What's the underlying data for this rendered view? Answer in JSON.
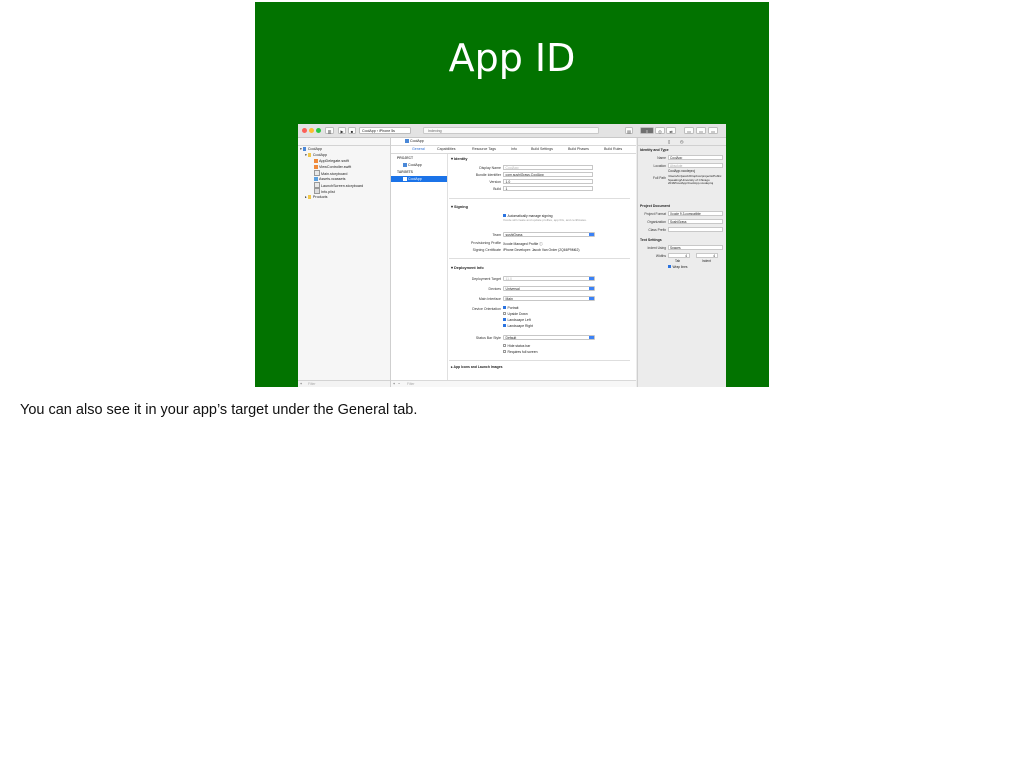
{
  "slide": {
    "title": "App ID",
    "caption": "You can also see it in your app’s target under the General tab."
  },
  "toolbar": {
    "scheme": "CoolApp",
    "device": "iPhone 5s",
    "status": "Indexing"
  },
  "navigator": {
    "items": [
      {
        "label": "CoolApp"
      },
      {
        "label": "CoolApp"
      },
      {
        "label": "AppDelegate.swift"
      },
      {
        "label": "ViewController.swift"
      },
      {
        "label": "Main.storyboard"
      },
      {
        "label": "Assets.xcassets"
      },
      {
        "label": "LaunchScreen.storyboard"
      },
      {
        "label": "Info.plist"
      },
      {
        "label": "Products"
      }
    ],
    "filter_placeholder": "Filter"
  },
  "editor": {
    "breadcrumb": "CoolApp",
    "tabs": [
      "General",
      "Capabilities",
      "Resource Tags",
      "Info",
      "Build Settings",
      "Build Phases",
      "Build Rules"
    ],
    "project_header": "PROJECT",
    "project_item": "CoolApp",
    "targets_header": "TARGETS",
    "target_item": "CoolApp",
    "identity": {
      "title": "Identity",
      "display_name_label": "Display Name",
      "display_name_placeholder": "CoolApp",
      "bundle_id_label": "Bundle Identifier",
      "bundle_id": "com.sushiGrass.CoolApp",
      "version_label": "Version",
      "version": "1.0",
      "build_label": "Build",
      "build": "1"
    },
    "signing": {
      "title": "Signing",
      "auto_label": "Automatically manage signing",
      "auto_note": "Xcode will create and update profiles, app IDs, and certificates.",
      "team_label": "Team",
      "team": "sushiGrass",
      "profile_label": "Provisioning Profile",
      "profile": "Xcode Managed Profile",
      "cert_label": "Signing Certificate",
      "cert": "iPhone Developer: Jacob Van Order (2Q66P9M62)"
    },
    "deployment": {
      "title": "Deployment Info",
      "target_label": "Deployment Target",
      "target": "11.0",
      "devices_label": "Devices",
      "devices": "Universal",
      "main_label": "Main Interface",
      "main": "Main",
      "orientation_label": "Device Orientation",
      "orientations": [
        {
          "label": "Portrait",
          "checked": true
        },
        {
          "label": "Upside Down",
          "checked": false
        },
        {
          "label": "Landscape Left",
          "checked": true
        },
        {
          "label": "Landscape Right",
          "checked": true
        }
      ],
      "statusbar_label": "Status Bar Style",
      "statusbar": "Default",
      "hide_statusbar": "Hide status bar",
      "requires_fullscreen": "Requires full screen"
    },
    "next_section": "App Icons and Launch Images",
    "filter_placeholder": "Filter"
  },
  "inspector": {
    "identity_title": "Identity and Type",
    "name_label": "Name",
    "name": "CoolApp",
    "location_label": "Location",
    "location": "Absolute",
    "file_label": "CoolApp.xcodeproj",
    "fullpath_label": "Full Path",
    "fullpath": "/Users/trc/jacob/Dropbox/projects/Public Speaking/University of Chicago 2018/CoolApp/CoolApp.xcodeproj",
    "doc_title": "Project Document",
    "format_label": "Project Format",
    "format": "Xcode 9.3-compatible",
    "org_label": "Organization",
    "org": "SushiGrass",
    "prefix_label": "Class Prefix",
    "prefix": "",
    "text_title": "Text Settings",
    "indent_label": "Indent Using",
    "indent": "Spaces",
    "widths_label": "Widths",
    "tab_value": "4",
    "indent_value": "4",
    "tab_label": "Tab",
    "indent_col_label": "Indent",
    "wrap_label": "Wrap lines"
  },
  "colors": {
    "slide_bg": "#027300",
    "selection": "#1b73e8"
  }
}
